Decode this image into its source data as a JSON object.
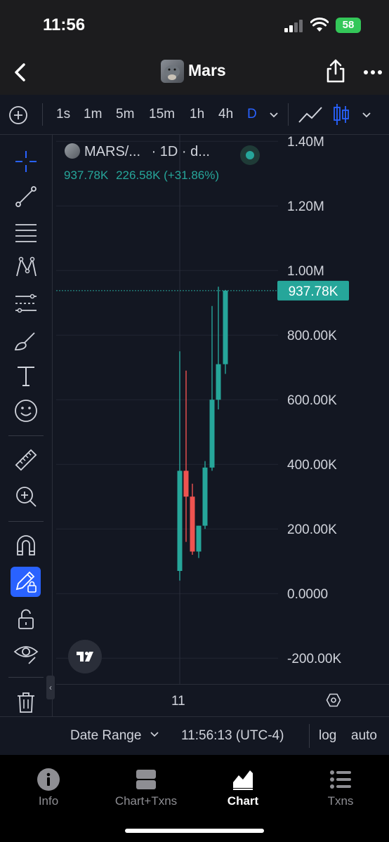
{
  "status_bar": {
    "time": "11:56",
    "battery": "58"
  },
  "nav": {
    "title": "Mars"
  },
  "timeframes": [
    {
      "label": "1s",
      "active": false
    },
    {
      "label": "1m",
      "active": false
    },
    {
      "label": "5m",
      "active": false
    },
    {
      "label": "15m",
      "active": false
    },
    {
      "label": "1h",
      "active": false
    },
    {
      "label": "4h",
      "active": false
    },
    {
      "label": "D",
      "active": true
    }
  ],
  "legend": {
    "symbol": "MARS/...",
    "interval": "· 1D · d...",
    "last": "937.78K",
    "change": "226.58K (+31.86%)"
  },
  "price_axis": {
    "labels": [
      "1.40M",
      "1.20M",
      "1.00M",
      "800.00K",
      "600.00K",
      "400.00K",
      "200.00K",
      "0.0000",
      "-200.00K"
    ],
    "current_price_label": "937.78K"
  },
  "time_axis": {
    "label": "11"
  },
  "bottom_toolbar": {
    "date_range": "Date Range",
    "clock": "11:56:13 (UTC-4)",
    "log": "log",
    "auto": "auto"
  },
  "tabs": [
    {
      "label": "Info",
      "icon": "info-icon",
      "active": false
    },
    {
      "label": "Chart+Txns",
      "icon": "chart-txns-icon",
      "active": false
    },
    {
      "label": "Chart",
      "icon": "chart-icon",
      "active": true
    },
    {
      "label": "Txns",
      "icon": "list-icon",
      "active": false
    }
  ],
  "colors": {
    "up": "#26a69a",
    "down": "#ef5350",
    "accent": "#2962ff",
    "background": "#131722"
  },
  "chart_data": {
    "type": "candlestick",
    "ylim": [
      -280000,
      1420000
    ],
    "current_price": 937780,
    "grid": true,
    "candles": [
      {
        "open": 70000,
        "high": 750000,
        "low": 40000,
        "close": 380000
      },
      {
        "open": 380000,
        "high": 690000,
        "low": 160000,
        "close": 300000
      },
      {
        "open": 300000,
        "high": 340000,
        "low": 120000,
        "close": 130000
      },
      {
        "open": 130000,
        "high": 210000,
        "low": 110000,
        "close": 210000
      },
      {
        "open": 210000,
        "high": 410000,
        "low": 200000,
        "close": 390000
      },
      {
        "open": 390000,
        "high": 890000,
        "low": 380000,
        "close": 600000
      },
      {
        "open": 600000,
        "high": 950000,
        "low": 570000,
        "close": 710000
      },
      {
        "open": 710000,
        "high": 940000,
        "low": 680000,
        "close": 937780
      }
    ]
  }
}
